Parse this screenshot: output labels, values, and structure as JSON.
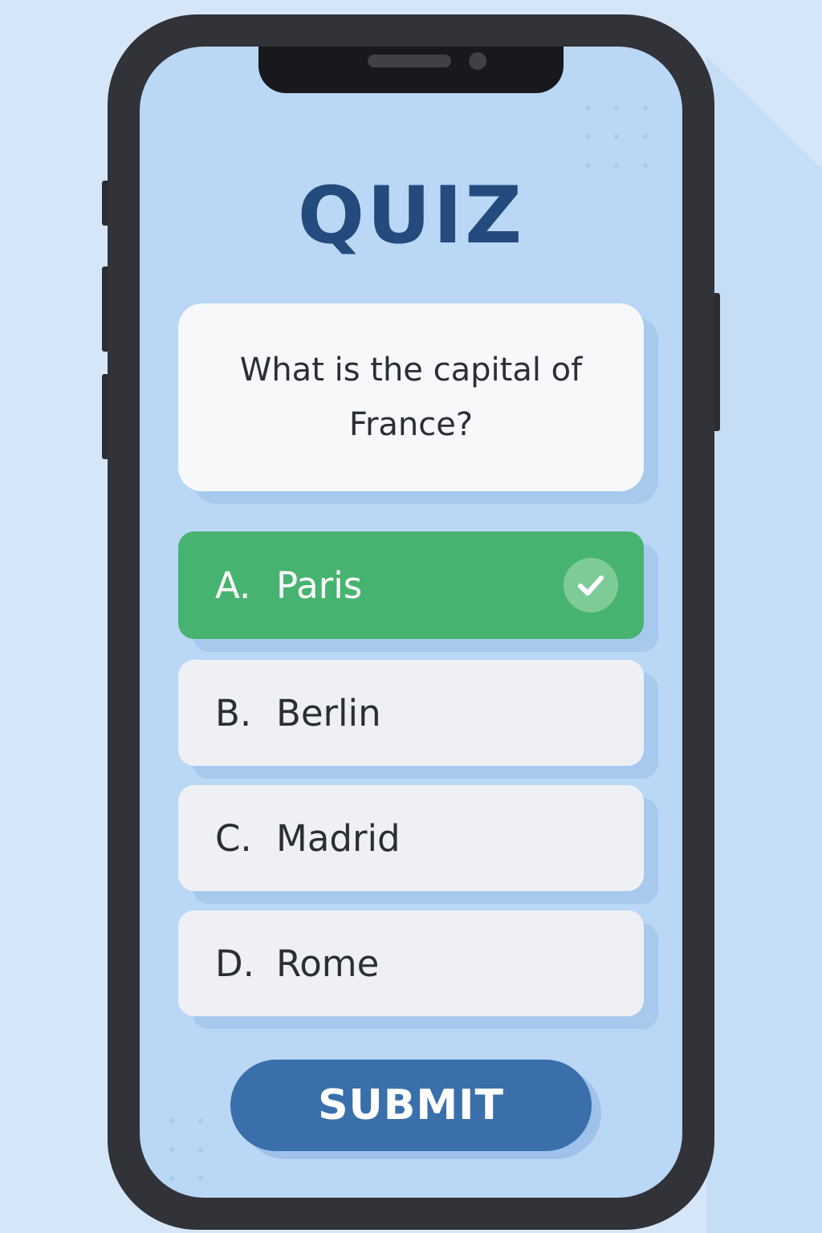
{
  "app": {
    "title": "QUIZ"
  },
  "question": {
    "text": "What is the capital of France?"
  },
  "options": [
    {
      "letter": "A.",
      "label": "Paris",
      "state": "correct"
    },
    {
      "letter": "B.",
      "label": "Berlin",
      "state": "default"
    },
    {
      "letter": "C.",
      "label": "Madrid",
      "state": "default"
    },
    {
      "letter": "D.",
      "label": "Rome",
      "state": "default"
    }
  ],
  "actions": {
    "submit_label": "SUBMIT"
  },
  "icons": {
    "selected_option": "checkmark-icon"
  },
  "colors": {
    "background": "#d5e6f8",
    "screen": "#bad7f5",
    "title": "#234b7d",
    "correct": "#47b370",
    "option": "#eef0f4",
    "submit": "#3a6fac"
  }
}
